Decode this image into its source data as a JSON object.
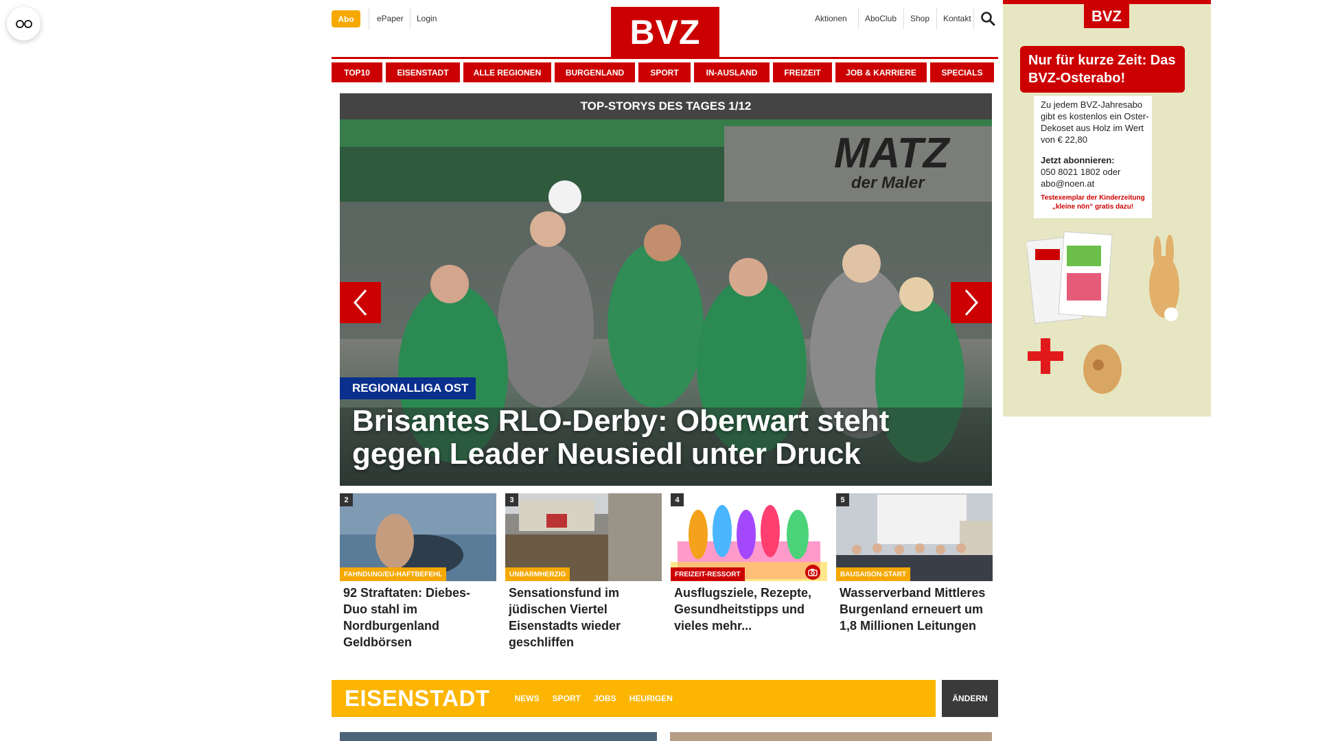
{
  "topbar": {
    "abo": "Abo",
    "epaper": "ePaper",
    "login": "Login",
    "aktionen": "Aktionen",
    "aboclub": "AboClub",
    "shop": "Shop",
    "kontakt": "Kontakt"
  },
  "logo": {
    "text": "BVZ"
  },
  "nav": {
    "items": [
      "TOP10",
      "EISENSTADT",
      "ALLE REGIONEN",
      "BURGENLAND",
      "SPORT",
      "IN-AUSLAND",
      "FREIZEIT",
      "JOB & KARRIERE",
      "SPECIALS"
    ]
  },
  "hero": {
    "header": "TOP-STORYS DES TAGES 1/12",
    "badge": "REGIONALLIGA OST",
    "title": "Brisantes RLO-Derby: Oberwart steht gegen Leader Neusiedl unter Druck",
    "banner_text": "MATZ",
    "banner_sub": "der Maler"
  },
  "cards": [
    {
      "num": "2",
      "tag": "FAHNDUNG/EU-HAFTBEFEHL",
      "title": "92 Straftaten: Diebes-Duo stahl im Nordburgenland Geldbörsen",
      "tag_color": "#f5a800"
    },
    {
      "num": "3",
      "tag": "UNBARMHERZIG",
      "title": "Sensationsfund im jüdischen Viertel Eisenstadts wieder geschliffen",
      "tag_color": "#f5a800"
    },
    {
      "num": "4",
      "tag": "FREIZEIT-RESSORT",
      "title": "Ausflugsziele, Rezepte, Gesundheitstipps und vieles mehr...",
      "tag_color": "#cc0000"
    },
    {
      "num": "5",
      "tag": "BAUSAISON-START",
      "title": "Wasserverband Mittleres Burgenland erneuert um 1,8 Millionen Leitungen",
      "tag_color": "#f5a800"
    }
  ],
  "eisenstadt": {
    "title": "EISENSTADT",
    "links": [
      "NEWS",
      "SPORT",
      "JOBS",
      "HEURIGEN"
    ],
    "aendern": "ÄNDERN"
  },
  "ad": {
    "logo": "BVZ",
    "headline": "Nur für kurze Zeit: Das BVZ-Osterabo!",
    "body": "Zu jedem BVZ-Jahresabo gibt es kostenlos ein Oster-Dekoset aus Holz im Wert von € 22,80",
    "cta_title": "Jetzt abonnieren:",
    "cta_body": "050 8021 1802 oder abo@noen.at",
    "red_text": "Testexemplar der Kinderzeitung „kleine nön“ gratis dazu!"
  },
  "colors": {
    "brand_red": "#cc0000",
    "accent_yellow": "#fcb500",
    "badge_blue": "#0a2f8c"
  }
}
